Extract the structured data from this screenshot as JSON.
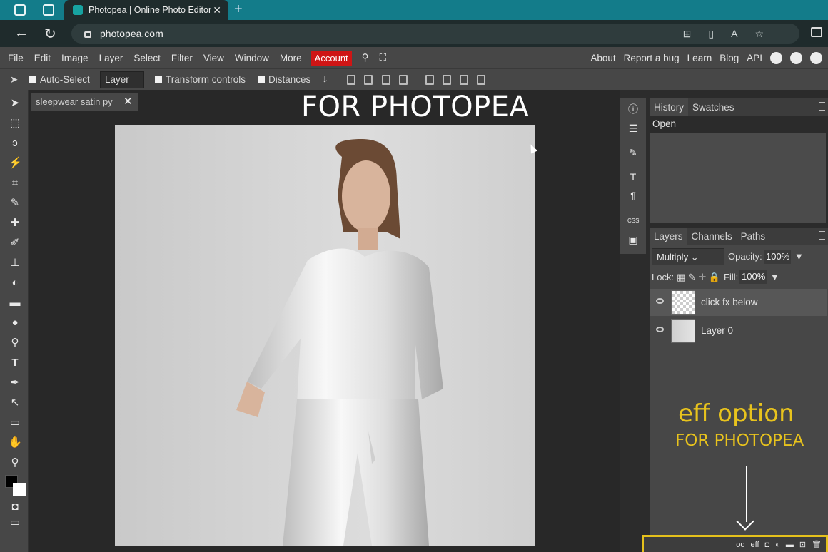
{
  "browser": {
    "tab_title": "Photopea | Online Photo Editor",
    "url": "photopea.com",
    "tab_close": "✕",
    "new_tab": "+"
  },
  "menu": {
    "items": [
      "File",
      "Edit",
      "Image",
      "Layer",
      "Select",
      "Filter",
      "View",
      "Window",
      "More"
    ],
    "account": "Account",
    "right_items": [
      "About",
      "Report a bug",
      "Learn",
      "Blog",
      "API"
    ]
  },
  "options": {
    "auto_select": "Auto-Select",
    "layer_select": "Layer",
    "transform_controls": "Transform controls",
    "distances": "Distances"
  },
  "document": {
    "tab_name": "sleepwear satin py",
    "tab_close": "✕",
    "overlay_title": "FOR PHOTOPEA"
  },
  "history_panel": {
    "tabs": [
      "History",
      "Swatches"
    ],
    "items": [
      "Open"
    ]
  },
  "layers_panel": {
    "tabs": [
      "Layers",
      "Channels",
      "Paths"
    ],
    "blend_mode": "Multiply",
    "opacity_label": "Opacity:",
    "opacity_value": "100%",
    "lock_label": "Lock:",
    "fill_label": "Fill:",
    "fill_value": "100%",
    "layers": [
      {
        "name": "click fx below",
        "selected": true
      },
      {
        "name": "Layer 0",
        "selected": false
      }
    ]
  },
  "annotation": {
    "line1": "eff option",
    "line2": "FOR PHOTOPEA",
    "bottom_icons": [
      "oo",
      "eff",
      "◘",
      "◐",
      "▬",
      "⊡",
      "🗑"
    ]
  },
  "colors": {
    "accent_teal": "#137c8a",
    "account_red": "#cf1515",
    "annotation_yellow": "#e8c31d"
  }
}
